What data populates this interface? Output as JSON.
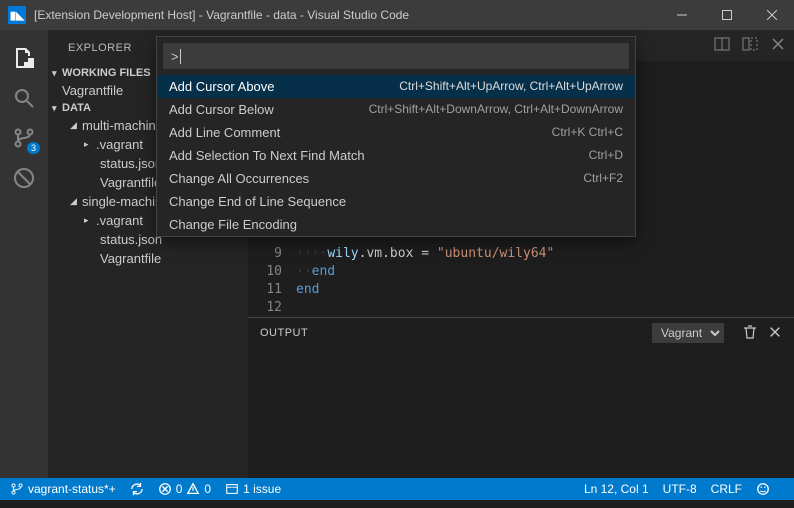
{
  "titlebar": {
    "title": "[Extension Development Host] - Vagrantfile - data - Visual Studio Code"
  },
  "sidebar": {
    "header": "EXPLORER",
    "working_files_label": "WORKING FILES",
    "working_files": [
      "Vagrantfile"
    ],
    "project_label": "DATA",
    "tree": {
      "multi_machine": "multi-machine",
      "vagrant1": ".vagrant",
      "status_json": "status.json",
      "vagrantfile1": "Vagrantfile",
      "single_machine": "single-machine",
      "vagrant2": ".vagrant",
      "status_json2": "status.json",
      "vagrantfile2": "Vagrantfile"
    }
  },
  "command_palette": {
    "prefix": ">",
    "items": [
      {
        "label": "Add Cursor Above",
        "shortcut": "Ctrl+Shift+Alt+UpArrow, Ctrl+Alt+UpArrow"
      },
      {
        "label": "Add Cursor Below",
        "shortcut": "Ctrl+Shift+Alt+DownArrow, Ctrl+Alt+DownArrow"
      },
      {
        "label": "Add Line Comment",
        "shortcut": "Ctrl+K Ctrl+C"
      },
      {
        "label": "Add Selection To Next Find Match",
        "shortcut": "Ctrl+D"
      },
      {
        "label": "Change All Occurrences",
        "shortcut": "Ctrl+F2"
      },
      {
        "label": "Change End of Line Sequence",
        "shortcut": ""
      },
      {
        "label": "Change File Encoding",
        "shortcut": ""
      }
    ]
  },
  "editor": {
    "lines": {
      "l9_a": "    wily",
      "l9_b": ".vm.box",
      "l9_c": " = ",
      "l9_d": "\"ubuntu/wily64\"",
      "l10": "  end",
      "l11": "end",
      "l12": ""
    },
    "line_numbers": [
      "9",
      "10",
      "11",
      "12"
    ]
  },
  "output": {
    "label": "OUTPUT",
    "channel": "Vagrant"
  },
  "statusbar": {
    "branch": "vagrant-status*+",
    "errors": "0",
    "warnings": "0",
    "issues": "1 issue",
    "position": "Ln 12, Col 1",
    "encoding": "UTF-8",
    "eol": "CRLF"
  },
  "activity_badge": "3"
}
